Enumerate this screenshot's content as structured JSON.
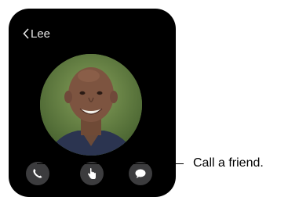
{
  "header": {
    "back_label": "Lee"
  },
  "contact": {
    "avatar_icon": "contact-photo"
  },
  "actions": [
    {
      "icon": "phone-icon",
      "selected": true
    },
    {
      "icon": "touch-icon",
      "selected": false
    },
    {
      "icon": "message-icon",
      "selected": false
    }
  ],
  "callout": {
    "text": "Call a friend."
  },
  "colors": {
    "screen": "#000000",
    "button": "#3c3c3e",
    "text": "#e6e6e6"
  }
}
